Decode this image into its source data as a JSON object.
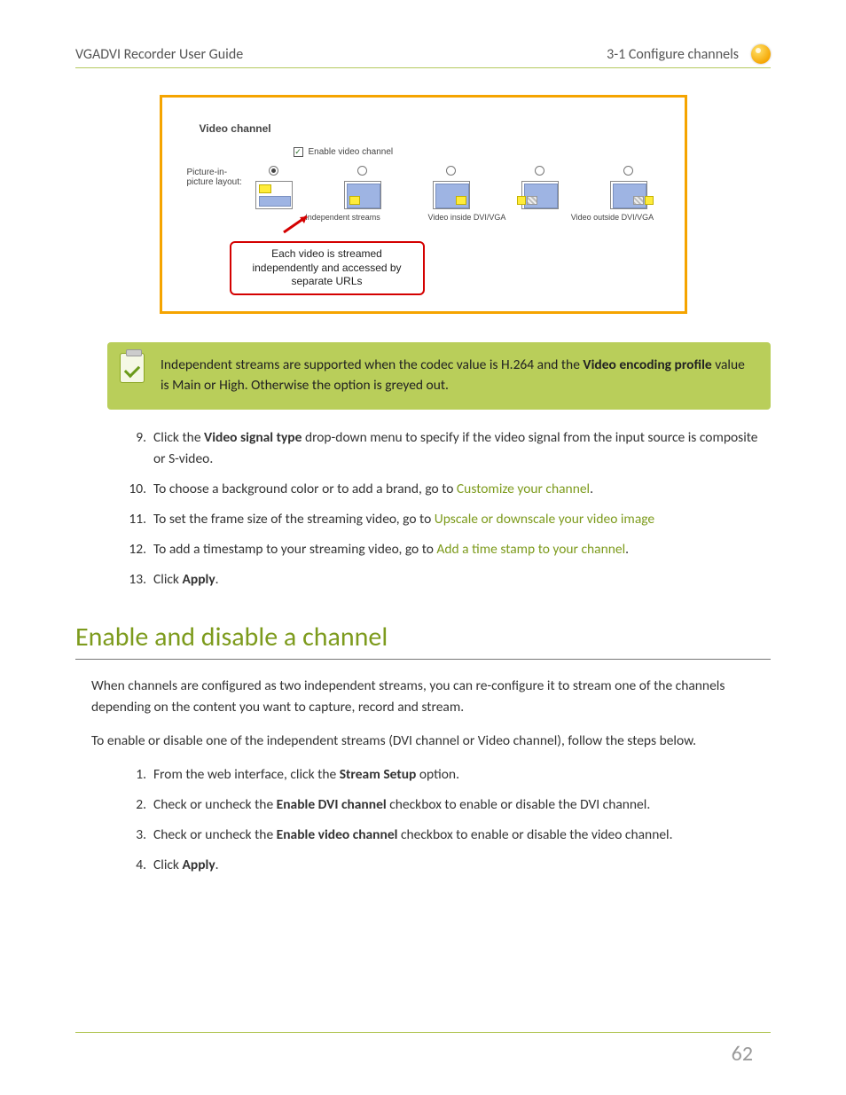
{
  "header": {
    "left": "VGADVI Recorder User Guide",
    "right": "3-1 Configure channels"
  },
  "figure": {
    "title": "Video channel",
    "enable_label": "Enable video channel",
    "enable_checked": true,
    "pip_label": "Picture-in-picture layout:",
    "caption1": "Independent streams",
    "caption2": "Video inside DVI/VGA",
    "caption3": "Video outside DVI/VGA",
    "callout": "Each video is streamed independently and accessed by separate URLs"
  },
  "note": {
    "pre": "Independent streams are supported when the codec value is H.264 and the ",
    "bold1": "Video encoding profile",
    "post": " value is Main or High. Otherwise the option is greyed out."
  },
  "steps9_13": {
    "s9a": "Click the ",
    "s9b": "Video signal type",
    "s9c": " drop-down menu to specify if the video signal from the input source is composite or S-video.",
    "s10a": "To choose a background color or to add a brand, go to ",
    "s10link": "Customize your channel",
    "s10b": ".",
    "s11a": "To set the frame size of the streaming video, go to ",
    "s11link": "Upscale or downscale your video image",
    "s12a": "To add a timestamp to your streaming video, go to ",
    "s12link": "Add a time stamp to your channel",
    "s12b": ".",
    "s13a": "Click ",
    "s13b": "Apply",
    "s13c": "."
  },
  "section_heading": "Enable and disable a channel",
  "para1": "When channels are configured as two independent streams, you can re-configure it to stream one of the channels depending on the content you want to capture, record and stream.",
  "para2": "To enable or disable one of the independent streams (DVI channel or Video channel), follow the steps below.",
  "sub_steps": {
    "s1a": "From the web interface, click the ",
    "s1b": "Stream Setup",
    "s1c": " option.",
    "s2a": "Check or uncheck the ",
    "s2b": "Enable DVI channel",
    "s2c": " checkbox to enable or disable the DVI channel.",
    "s3a": "Check or uncheck the ",
    "s3b": "Enable video channel",
    "s3c": " checkbox to enable or disable the video channel.",
    "s4a": "Click ",
    "s4b": "Apply",
    "s4c": "."
  },
  "page_number": "62"
}
